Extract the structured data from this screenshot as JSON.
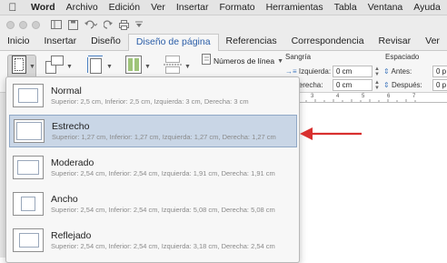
{
  "menubar": {
    "apple": "",
    "items": [
      "Word",
      "Archivo",
      "Edición",
      "Ver",
      "Insertar",
      "Formato",
      "Herramientas",
      "Tabla",
      "Ventana",
      "Ayuda"
    ]
  },
  "ribbon_tabs": [
    "Inicio",
    "Insertar",
    "Diseño",
    "Diseño de página",
    "Referencias",
    "Correspondencia",
    "Revisar",
    "Ver"
  ],
  "active_tab": "Diseño de página",
  "ribbon": {
    "line_numbers_label": "Números de línea",
    "indent_title": "Sangría",
    "spacing_title": "Espaciado",
    "left_label": "Izquierda:",
    "left_value": "0 cm",
    "right_label": "Derecha:",
    "right_value": "0 cm",
    "before_label": "Antes:",
    "after_label": "Después:",
    "before_value": "0 p",
    "after_value": "0 p"
  },
  "ruler_marks": [
    "3",
    "4",
    "5",
    "6",
    "7"
  ],
  "margins": {
    "options": [
      {
        "name": "Normal",
        "desc": "Superior: 2,5 cm, Inferior: 2,5 cm, Izquierda: 3 cm, Derecha: 3 cm"
      },
      {
        "name": "Estrecho",
        "desc": "Superior: 1,27 cm, Inferior: 1,27 cm, Izquierda: 1,27 cm, Derecha: 1,27 cm"
      },
      {
        "name": "Moderado",
        "desc": "Superior: 2,54 cm, Inferior: 2,54 cm, Izquierda: 1,91 cm, Derecha: 1,91 cm"
      },
      {
        "name": "Ancho",
        "desc": "Superior: 2,54 cm, Inferior: 2,54 cm, Izquierda: 5,08 cm, Derecha: 5,08 cm"
      },
      {
        "name": "Reflejado",
        "desc": "Superior: 2,54 cm, Inferior: 2,54 cm, Izquierda: 3,18 cm, Derecha: 2,54 cm"
      }
    ],
    "selected": "Estrecho"
  },
  "colors": {
    "accent_tab": "#2b5ea8",
    "selection": "#c9d6e6",
    "arrow": "#d8302f"
  }
}
